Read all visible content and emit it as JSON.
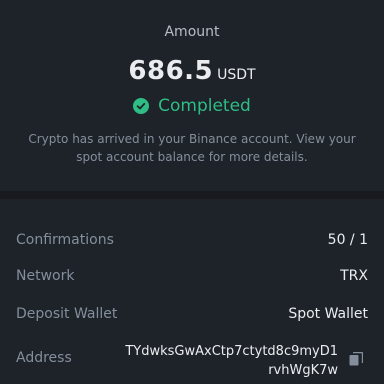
{
  "summary": {
    "amount_label": "Amount",
    "amount_value": "686.5",
    "amount_unit": "USDT",
    "status": "Completed",
    "status_icon": "check-circle-icon",
    "note": "Crypto has arrived in your Binance account. View your spot account balance for more details."
  },
  "details": {
    "confirmations": {
      "label": "Confirmations",
      "value": "50 / 1"
    },
    "network": {
      "label": "Network",
      "value": "TRX"
    },
    "deposit_wallet": {
      "label": "Deposit Wallet",
      "value": "Spot Wallet"
    },
    "address": {
      "label": "Address",
      "value": "TYdwksGwAxCtp7ctytd8c9myD1rvhWgK7w",
      "copy_icon": "copy-icon"
    }
  },
  "colors": {
    "background": "#1e2329",
    "divider": "#181a20",
    "success": "#2ebd85",
    "text_primary": "#eaecef",
    "text_secondary": "#848e9c"
  }
}
